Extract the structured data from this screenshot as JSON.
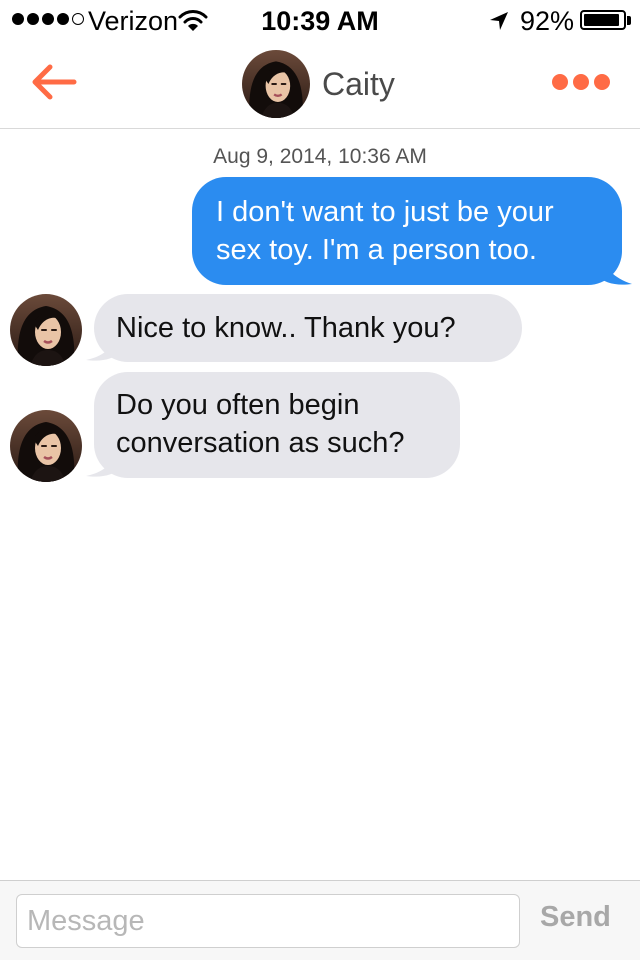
{
  "status_bar": {
    "signal_filled": 4,
    "signal_total": 5,
    "carrier": "Verizon",
    "time": "10:39 AM",
    "battery_text": "92%",
    "battery_level": 0.92,
    "icons": [
      "wifi-icon",
      "location-arrow-icon",
      "battery-icon"
    ]
  },
  "header": {
    "back_icon": "back-arrow-icon",
    "contact_name": "Caity",
    "more_icon": "more-dots-icon",
    "accent_color": "#ff6b45"
  },
  "conversation": {
    "timestamp": "Aug 9, 2014, 10:36 AM",
    "messages": [
      {
        "direction": "sent",
        "lines": [
          "I don't want to just be your",
          "sex toy. I'm a person too."
        ]
      },
      {
        "direction": "received",
        "lines": [
          "Nice to know.. Thank you?"
        ]
      },
      {
        "direction": "received",
        "lines": [
          "Do you often begin",
          "conversation as such?"
        ]
      }
    ],
    "sent_color": "#2b8cf0",
    "received_color": "#e6e6eb"
  },
  "composer": {
    "placeholder": "Message",
    "value": "",
    "send_label": "Send"
  }
}
